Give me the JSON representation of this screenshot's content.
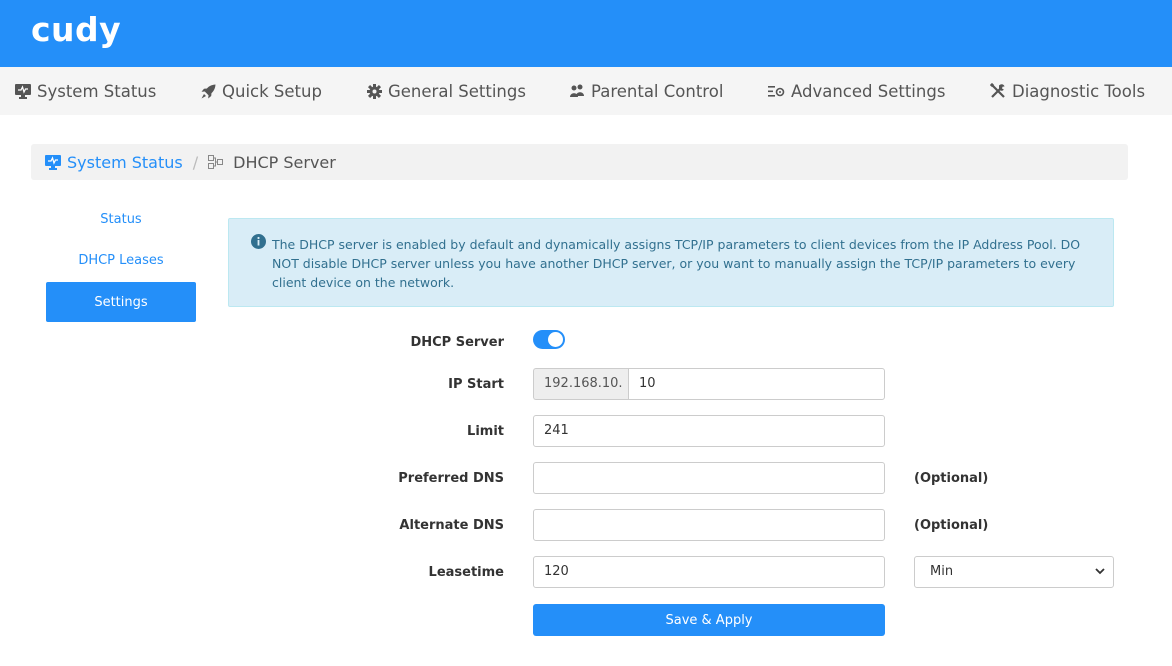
{
  "brand": {
    "logo_text": "cudy",
    "color": "#248ff9"
  },
  "nav": {
    "items": [
      {
        "label": "System Status",
        "icon": "monitor-icon"
      },
      {
        "label": "Quick Setup",
        "icon": "rocket-icon"
      },
      {
        "label": "General Settings",
        "icon": "gear-icon"
      },
      {
        "label": "Parental Control",
        "icon": "users-icon"
      },
      {
        "label": "Advanced Settings",
        "icon": "list-gear-icon"
      },
      {
        "label": "Diagnostic Tools",
        "icon": "tools-icon"
      }
    ]
  },
  "breadcrumb": {
    "home": "System Status",
    "separator": "/",
    "current": "DHCP Server"
  },
  "sidebar": {
    "items": [
      {
        "label": "Status"
      },
      {
        "label": "DHCP Leases"
      },
      {
        "label": "Settings",
        "active": true
      }
    ]
  },
  "info": {
    "text": "The DHCP server is enabled by default and dynamically assigns TCP/IP parameters to client devices from the IP Address Pool. DO NOT disable DHCP server unless you have another DHCP server, or you want to manually assign the TCP/IP parameters to every client device on the network."
  },
  "form": {
    "dhcp_server": {
      "label": "DHCP Server",
      "enabled": true
    },
    "ip_start": {
      "label": "IP Start",
      "prefix": "192.168.10.",
      "value": "10"
    },
    "limit": {
      "label": "Limit",
      "value": "241"
    },
    "preferred_dns": {
      "label": "Preferred DNS",
      "value": "",
      "hint": "(Optional)"
    },
    "alternate_dns": {
      "label": "Alternate DNS",
      "value": "",
      "hint": "(Optional)"
    },
    "leasetime": {
      "label": "Leasetime",
      "value": "120",
      "unit": "Min"
    },
    "save_label": "Save & Apply"
  }
}
